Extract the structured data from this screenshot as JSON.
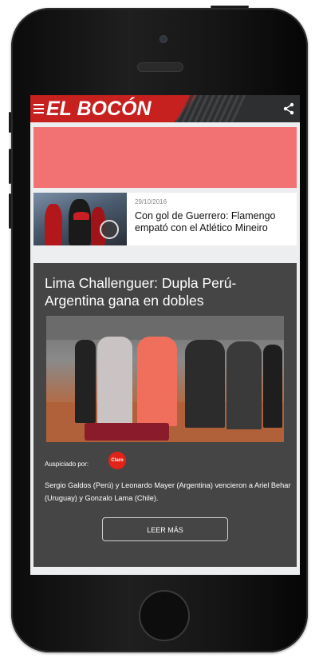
{
  "app": {
    "logo_text": "EL BOCÓN",
    "brand_color": "#c6201f"
  },
  "ad": {
    "color": "#f27173"
  },
  "news_item": {
    "date": "29/10/2016",
    "headline": "Con gol de Guerrero: Flamengo empató con el Atlético Mineiro"
  },
  "feature": {
    "title": "Lima Challenguer: Dupla Perú- Argentina gana en dobles",
    "sponsor_label": "Auspiciado por:",
    "sponsor_logo": "Claro",
    "description": "Sergio Galdos (Perú) y Leonardo Mayer (Argentina) vencieron a Ariel Behar (Uruguay) y Gonzalo Lama (Chile).",
    "read_more": "LEER MÁS"
  },
  "icons": {
    "menu": "menu-icon",
    "share": "share-icon",
    "play": "play-icon"
  }
}
